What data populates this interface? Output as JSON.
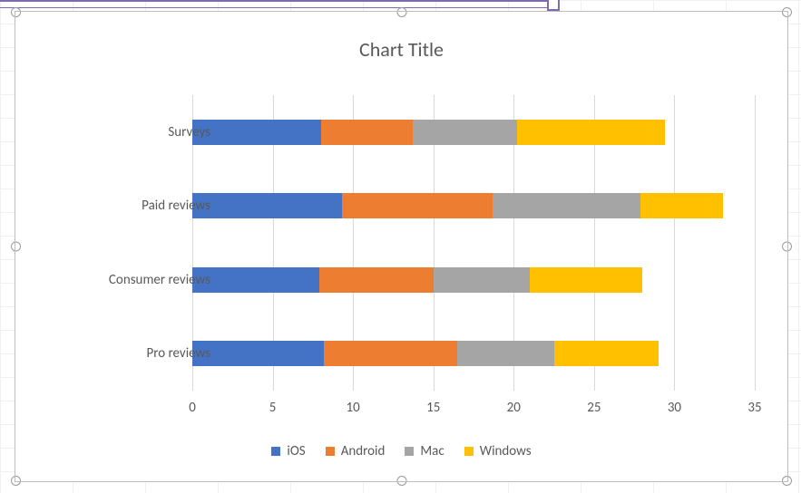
{
  "chart_data": {
    "type": "bar",
    "orientation": "horizontal",
    "stacked": true,
    "title": "Chart Title",
    "xlabel": "",
    "ylabel": "",
    "xlim": [
      0,
      35
    ],
    "xticks": [
      0,
      5,
      10,
      15,
      20,
      25,
      30,
      35
    ],
    "categories": [
      "Pro reviews",
      "Consumer reviews",
      "Paid reviews",
      "Surveys"
    ],
    "series": [
      {
        "name": "iOS",
        "color": "#4472C4",
        "values": [
          8.2,
          7.9,
          9.3,
          8.0
        ]
      },
      {
        "name": "Android",
        "color": "#ED7D31",
        "values": [
          8.3,
          7.1,
          9.4,
          5.7
        ]
      },
      {
        "name": "Mac",
        "color": "#A5A5A5",
        "values": [
          6.0,
          6.0,
          9.2,
          6.5
        ]
      },
      {
        "name": "Windows",
        "color": "#FFC000",
        "values": [
          6.5,
          7.0,
          5.1,
          9.2
        ]
      }
    ],
    "legend_position": "bottom",
    "grid": {
      "x": true,
      "y": false
    }
  }
}
